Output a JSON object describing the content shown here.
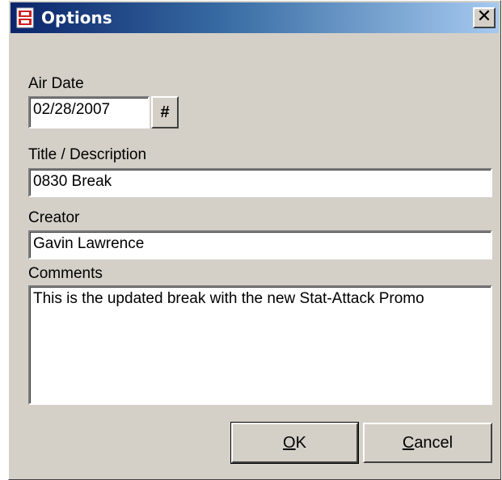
{
  "window": {
    "title": "Options",
    "close_glyph": "✕"
  },
  "fields": {
    "air_date": {
      "label": "Air Date",
      "value": "02/28/2007",
      "picker_label": "#"
    },
    "title": {
      "label": "Title / Description",
      "value": "0830 Break"
    },
    "creator": {
      "label": "Creator",
      "value": "Gavin Lawrence"
    },
    "comments": {
      "label": "Comments",
      "value": "This is the updated break with the new Stat-Attack Promo"
    }
  },
  "buttons": {
    "ok": {
      "mnemonic": "O",
      "rest": "K"
    },
    "cancel": {
      "mnemonic": "C",
      "rest": "ancel"
    }
  },
  "colors": {
    "face": "#d4d0c8",
    "title_start": "#0a246a",
    "title_end": "#a6caf0"
  }
}
